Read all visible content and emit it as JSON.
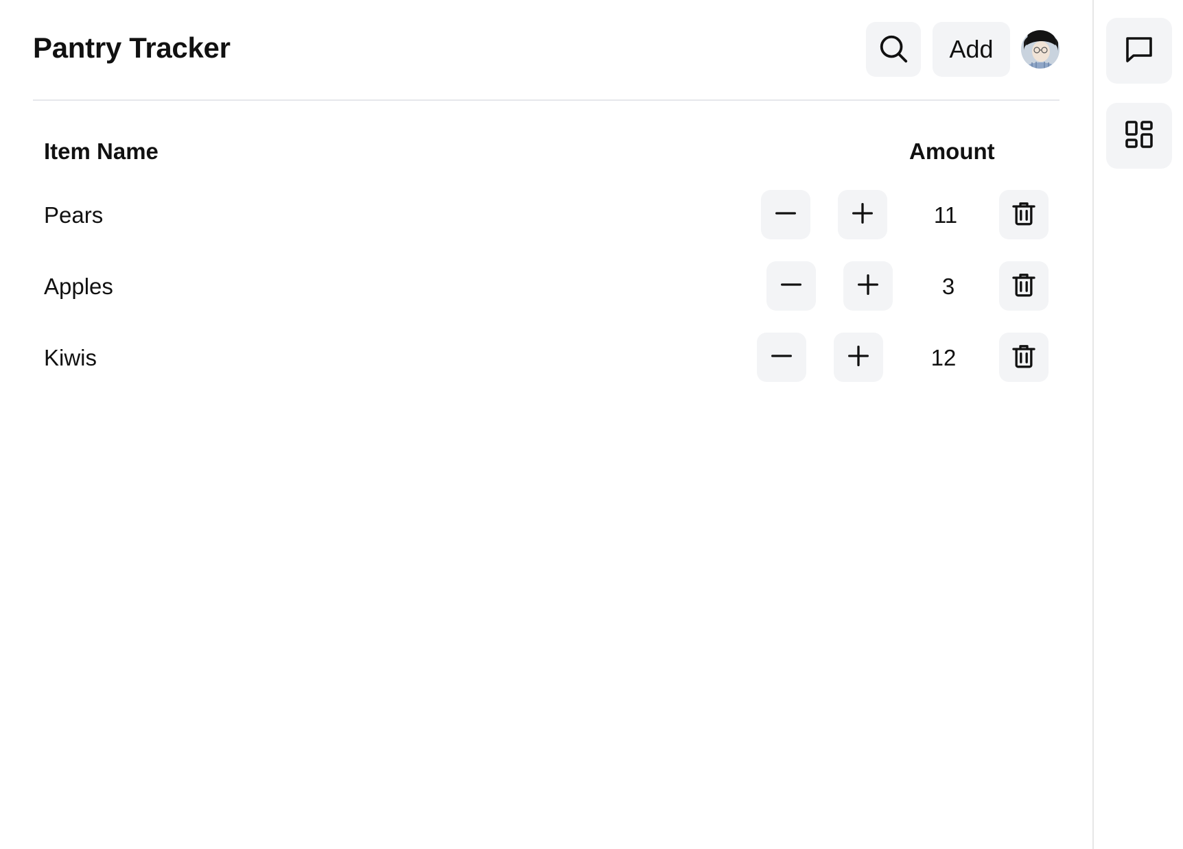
{
  "header": {
    "title": "Pantry Tracker",
    "add_label": "Add"
  },
  "table": {
    "columns": [
      "Item Name",
      "Amount"
    ],
    "rows": [
      {
        "name": "Pears",
        "amount": "11"
      },
      {
        "name": "Apples",
        "amount": "3"
      },
      {
        "name": "Kiwis",
        "amount": "12"
      }
    ]
  },
  "icons": {
    "search": "search-icon",
    "minus": "minus-icon",
    "plus": "plus-icon",
    "delete": "trash-icon",
    "chat": "chat-icon",
    "widgets": "dashboard-icon"
  },
  "colors": {
    "button_bg": "#f3f4f6",
    "divider": "#e5e7eb",
    "text": "#111111"
  }
}
